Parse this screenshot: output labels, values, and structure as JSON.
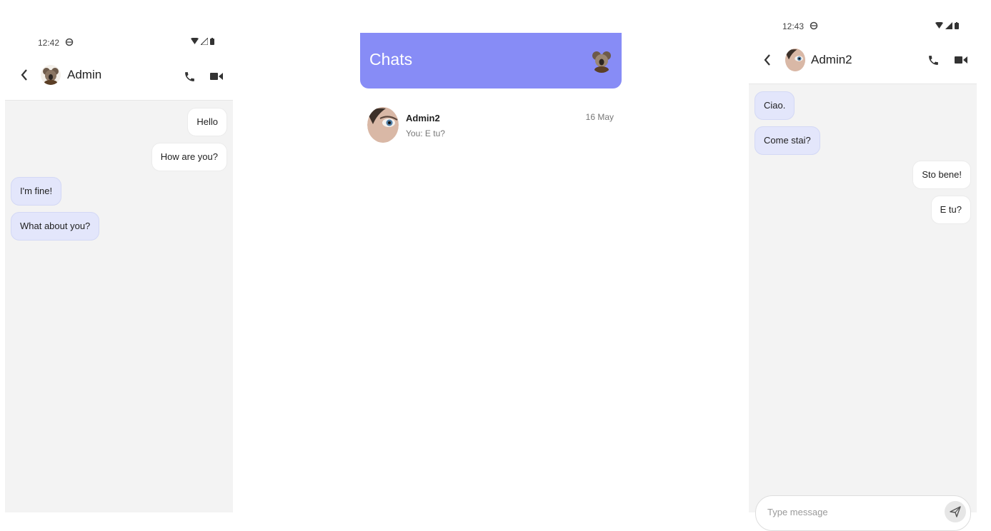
{
  "left_phone": {
    "status_time": "12:42",
    "contact_name": "Admin",
    "messages": [
      {
        "text": "Hello",
        "direction": "outgoing"
      },
      {
        "text": "How are you?",
        "direction": "outgoing"
      },
      {
        "text": "I'm fine!",
        "direction": "incoming"
      },
      {
        "text": "What about you?",
        "direction": "incoming"
      }
    ]
  },
  "middle_phone": {
    "title": "Chats",
    "chat_list": [
      {
        "name": "Admin2",
        "preview": "You: E tu?",
        "date": "16 May"
      }
    ]
  },
  "right_phone": {
    "status_time": "12:43",
    "contact_name": "Admin2",
    "messages": [
      {
        "text": "Ciao.",
        "direction": "incoming"
      },
      {
        "text": "Come stai?",
        "direction": "incoming"
      },
      {
        "text": "Sto bene!",
        "direction": "outgoing"
      },
      {
        "text": "E tu?",
        "direction": "outgoing"
      }
    ],
    "input_placeholder": "Type message"
  },
  "icons": {
    "back": "chevron-left-icon",
    "call": "phone-icon",
    "video": "video-camera-icon",
    "send": "send-icon",
    "wifi": "wifi-icon",
    "signal": "signal-icon",
    "battery": "battery-icon"
  },
  "colors": {
    "accent": "#878cf6",
    "incoming_bubble": "#e3e6fb",
    "outgoing_bubble": "#ffffff",
    "chat_background": "#f3f3f3"
  }
}
